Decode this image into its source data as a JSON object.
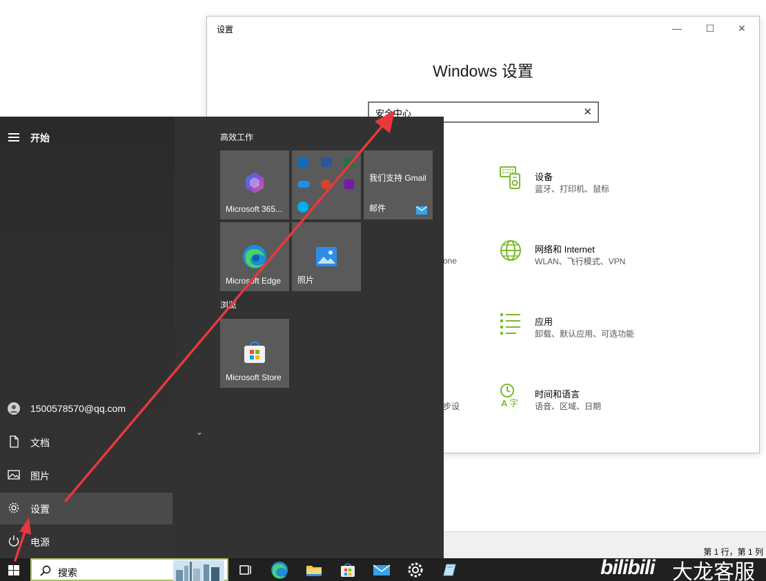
{
  "settings": {
    "window_title": "设置",
    "heading": "Windows 设置",
    "search_value": "安全中心",
    "accent": "#7cb82f",
    "categories": [
      {
        "name": "设备",
        "desc": "蓝牙、打印机、鼠标",
        "icon": "devices-icon"
      },
      {
        "name": "网络和 Internet",
        "desc": "WLAN、飞行模式、VPN",
        "icon": "globe-icon"
      },
      {
        "name": "应用",
        "desc": "卸载、默认应用、可选功能",
        "icon": "apps-list-icon"
      },
      {
        "name": "时间和语言",
        "desc": "语音、区域、日期",
        "icon": "time-language-icon"
      }
    ],
    "clipped_text": [
      "one",
      "步设"
    ]
  },
  "statusbar": {
    "cursor_pos": "第 1 行，第 1 列"
  },
  "start_menu": {
    "title": "开始",
    "nav": [
      {
        "label": "1500578570@qq.com",
        "icon": "user-icon"
      },
      {
        "label": "文档",
        "icon": "document-icon"
      },
      {
        "label": "图片",
        "icon": "pictures-icon"
      },
      {
        "label": "设置",
        "icon": "gear-icon"
      },
      {
        "label": "电源",
        "icon": "power-icon"
      }
    ],
    "groups": [
      "高效工作",
      "浏览"
    ],
    "tiles": {
      "m365": "Microsoft 365...",
      "gmail_line1": "我们支持 Gmail",
      "mail": "邮件",
      "edge": "Microsoft Edge",
      "photos": "照片",
      "store": "Microsoft Store"
    }
  },
  "taskbar": {
    "search_placeholder": "搜索",
    "watermark_logo": "bilibili",
    "watermark_name": "大龙客服"
  },
  "annotation_color": "#e8383d"
}
